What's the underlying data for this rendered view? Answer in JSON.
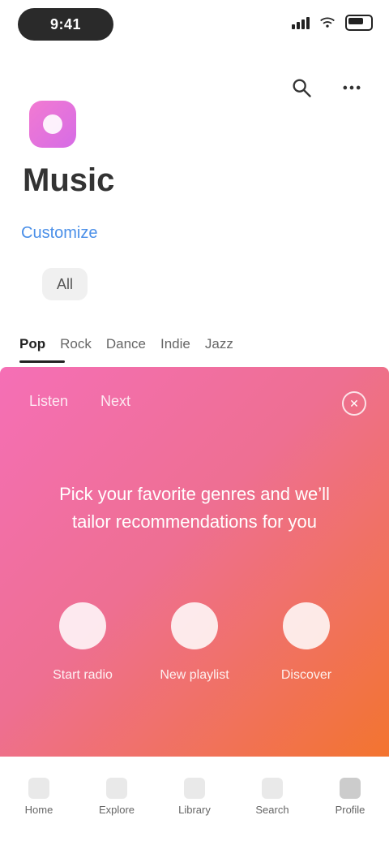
{
  "status_bar": {
    "time": "9:41"
  },
  "header": {
    "title": "Music",
    "link_text": "Customize"
  },
  "chip": {
    "label": "All"
  },
  "tabs": [
    {
      "label": "Pop"
    },
    {
      "label": "Rock"
    },
    {
      "label": "Dance"
    },
    {
      "label": "Indie"
    },
    {
      "label": "Jazz"
    }
  ],
  "card": {
    "header_left": "Listen",
    "header_mid": "Next",
    "headline": "Pick your favorite genres and we’ll tailor recommendations for you",
    "options": [
      {
        "label": "Start radio"
      },
      {
        "label": "New playlist"
      },
      {
        "label": "Discover"
      }
    ]
  },
  "bottom_nav": [
    {
      "label": "Home"
    },
    {
      "label": "Explore"
    },
    {
      "label": "Library"
    },
    {
      "label": "Search"
    },
    {
      "label": "Profile"
    }
  ],
  "colors": {
    "link": "#4a8fe8",
    "card_gradient_start": "#f56fb6",
    "card_gradient_end": "#f3742f"
  },
  "icons": {
    "top_action_1": "search-icon",
    "top_action_2": "more-icon",
    "app_icon": "music-icon",
    "card_close": "close-icon"
  }
}
